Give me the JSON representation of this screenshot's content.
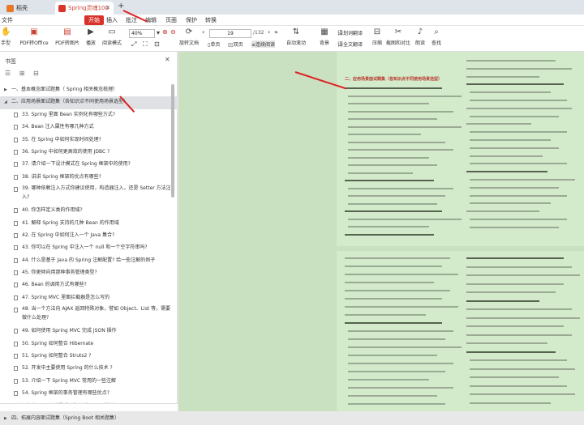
{
  "tabs": [
    {
      "label": "稻壳",
      "kind": "home"
    },
    {
      "label": "Spring灵魂100问.pdf",
      "kind": "doc"
    }
  ],
  "menubar": {
    "items": [
      "文件",
      "开始",
      "插入",
      "批注",
      "编辑",
      "页面",
      "保护",
      "转换"
    ],
    "active": "开始"
  },
  "toolbar": {
    "items": [
      {
        "label": "手型",
        "icon": "hand-icon"
      },
      {
        "label": "PDF转Office",
        "icon": "pdf-to-office-icon"
      },
      {
        "label": "PDF转图片",
        "icon": "pdf-to-image-icon"
      },
      {
        "label": "播放",
        "icon": "play-icon"
      },
      {
        "label": "阅读模式",
        "icon": "read-mode-icon"
      },
      {
        "label": "旋转文档",
        "icon": "rotate-icon"
      },
      {
        "label": "单页",
        "icon": "single-page-icon"
      },
      {
        "label": "双页",
        "icon": "double-page-icon"
      },
      {
        "label": "连续阅读",
        "icon": "continuous-icon"
      },
      {
        "label": "自动滚动",
        "icon": "auto-scroll-icon"
      },
      {
        "label": "背景",
        "icon": "background-icon"
      },
      {
        "label": "划词翻译",
        "icon": "translate-icon"
      },
      {
        "label": "全文翻译",
        "icon": "full-translate-icon"
      },
      {
        "label": "压缩",
        "icon": "compress-icon"
      },
      {
        "label": "截图和对比",
        "icon": "screenshot-icon"
      },
      {
        "label": "朗读",
        "icon": "read-aloud-icon"
      },
      {
        "label": "查找",
        "icon": "search-icon"
      }
    ],
    "zoom": "40%",
    "page_current": "19",
    "page_total": "/132"
  },
  "sidebar": {
    "title": "书签",
    "items": [
      {
        "label": "一、基本概念面试题集（ Spring 相关概念梳理）",
        "level": 1,
        "expanded": false,
        "selected": false
      },
      {
        "label": "二、应用场景面试题集（各知识点不同使用场景选型）",
        "level": 1,
        "expanded": true,
        "selected": true
      },
      {
        "label": "33. Spring 里面 Bean 实例化有哪些方式?",
        "level": 2
      },
      {
        "label": "34. Bean 注入属性有哪几种方式",
        "level": 2
      },
      {
        "label": "35. 在 Spring 中如何实现时间处理?",
        "level": 2
      },
      {
        "label": "36. Spring 中如何更高效的使用 JDBC ?",
        "level": 2
      },
      {
        "label": "37. 请介绍一下设计模式在 Spring 框架中的使用?",
        "level": 2
      },
      {
        "label": "38. 讲讲 Spring 框架的优点有哪些?",
        "level": 2
      },
      {
        "label": "39. 哪种依赖注入方式你建议使用，构造器注入，还是 Setter 方法注入?",
        "level": 2,
        "two_line": true
      },
      {
        "label": "40. 你怎样定义类的作用域?",
        "level": 2
      },
      {
        "label": "41. 解释 Spring 支持的几种 Bean 的作用域",
        "level": 2
      },
      {
        "label": "42. 在 Spring 中如何注入一个 Java 集合?",
        "level": 2
      },
      {
        "label": "43. 你可以在 Spring 中注入一个 null 和一个空字符串吗?",
        "level": 2
      },
      {
        "label": "44. 什么是基于 Java 的 Spring 注解配置? 给一些注解的例子",
        "level": 2
      },
      {
        "label": "45. 你更倾向用那种事务管理类型?",
        "level": 2
      },
      {
        "label": "46. Bean 的调用方式有哪些?",
        "level": 2
      },
      {
        "label": "47. Spring MVC 里面拦截器是怎么写的",
        "level": 2
      },
      {
        "label": "48. 当一个方法向 AJAX 返回特殊对象，譬如 Object、List 等，需要做什么处理?",
        "level": 2,
        "two_line": true
      },
      {
        "label": "49. 如何使用 Spring MVC 完成 JSON 操作",
        "level": 2
      },
      {
        "label": "50. Spring 如何整合 Hibernate",
        "level": 2
      },
      {
        "label": "51. Spring 如何整合 Struts2 ?",
        "level": 2
      },
      {
        "label": "52. 开发中主要使用 Spring 的什么技术 ?",
        "level": 2
      },
      {
        "label": "53. 介绍一下 Spring MVC 常用的一些注解",
        "level": 2
      },
      {
        "label": "54. Spring 框架的事务管理有哪些优点?",
        "level": 2
      },
      {
        "label": "三、深度底层原理面试题集（源码实现原理详解）",
        "level": 1,
        "expanded": false
      },
      {
        "label": "四、拓展内容面试题集（Spring Boot 相关题集）",
        "level": 1,
        "expanded": false
      }
    ]
  },
  "document": {
    "page_title": "二、应用场景面试题集（各知识点不同使用场景选型）",
    "first_q": "33. Spring 里面 Bean 实例化有哪些方式?"
  },
  "colors": {
    "accent": "#d9312a",
    "reading_bg": "#c9e1c0",
    "arrow": "#e02020"
  }
}
